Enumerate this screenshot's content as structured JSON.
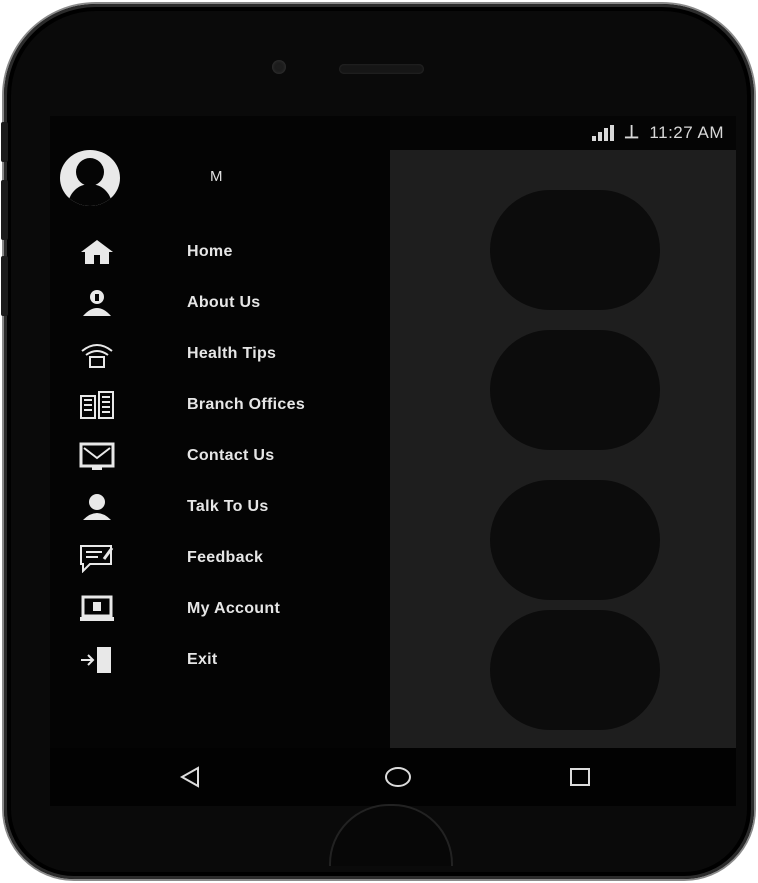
{
  "status_bar": {
    "time": "11:27 AM",
    "notification_icons": [
      "mail-icon",
      "image-icon",
      "circle-notification-icon"
    ],
    "system_icons": [
      "signal-icon",
      "usb-icon"
    ]
  },
  "drawer": {
    "user_name": "M",
    "items": [
      {
        "label": "Home",
        "icon": "home-icon"
      },
      {
        "label": "About Us",
        "icon": "about-icon"
      },
      {
        "label": "Health Tips",
        "icon": "health-tips-icon"
      },
      {
        "label": "Branch Offices",
        "icon": "branch-offices-icon"
      },
      {
        "label": "Contact Us",
        "icon": "contact-icon"
      },
      {
        "label": "Talk To Us",
        "icon": "talk-icon"
      },
      {
        "label": "Feedback",
        "icon": "feedback-icon"
      },
      {
        "label": "My Account",
        "icon": "account-icon"
      },
      {
        "label": "Exit",
        "icon": "exit-icon"
      }
    ]
  },
  "nav_bar": {
    "buttons": [
      "back-icon",
      "home-circle-icon",
      "recents-icon"
    ]
  },
  "colors": {
    "drawer_bg": "#040404",
    "text": "#e6e6e6",
    "bezel": "#0a0a0a"
  }
}
